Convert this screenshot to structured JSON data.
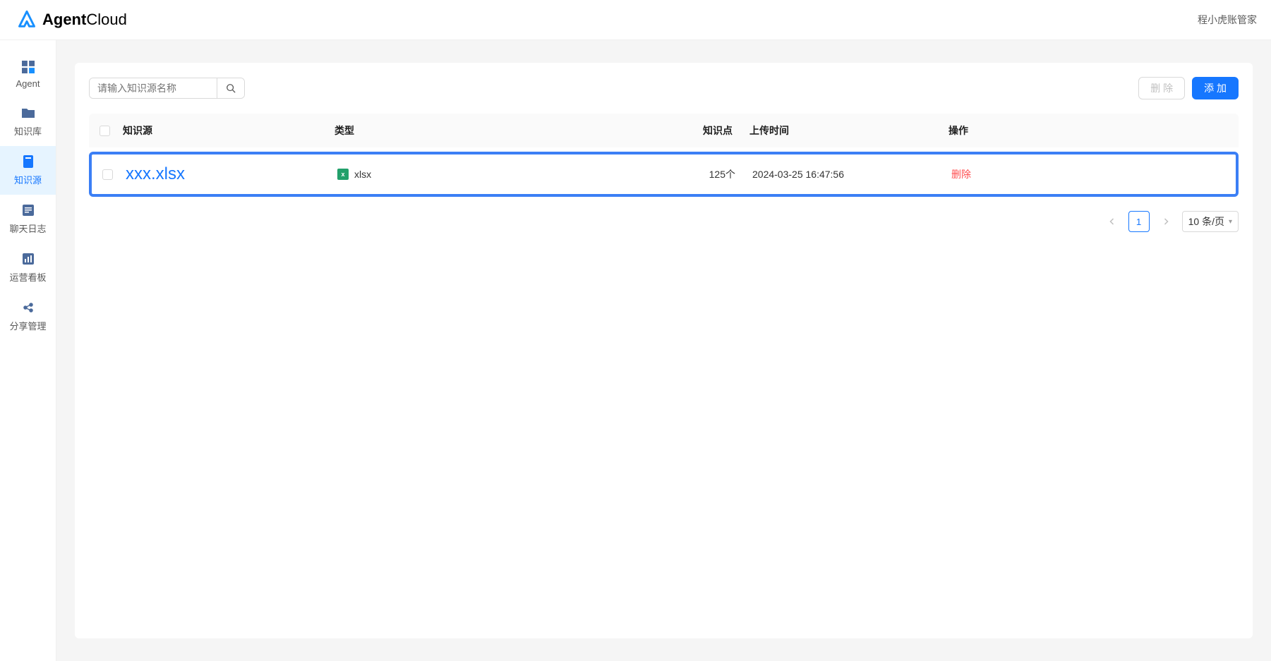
{
  "header": {
    "logo_bold": "Agent",
    "logo_light": "Cloud",
    "user_label": "程小虎账管家"
  },
  "sidebar": {
    "items": [
      {
        "label": "Agent",
        "icon": "grid"
      },
      {
        "label": "知识库",
        "icon": "folder"
      },
      {
        "label": "知识源",
        "icon": "book"
      },
      {
        "label": "聊天日志",
        "icon": "chat"
      },
      {
        "label": "运营看板",
        "icon": "chart"
      },
      {
        "label": "分享管理",
        "icon": "share"
      }
    ],
    "active_index": 2
  },
  "toolbar": {
    "search_placeholder": "请输入知识源名称",
    "delete_label": "删 除",
    "add_label": "添 加"
  },
  "table": {
    "columns": {
      "source": "知识源",
      "type": "类型",
      "points": "知识点",
      "upload_time": "上传时间",
      "action": "操作"
    },
    "rows": [
      {
        "name": "xxx.xlsx",
        "type": "xlsx",
        "points": "125个",
        "upload_time": "2024-03-25 16:47:56",
        "action": "删除"
      }
    ]
  },
  "pagination": {
    "current": "1",
    "page_size_label": "10 条/页"
  }
}
